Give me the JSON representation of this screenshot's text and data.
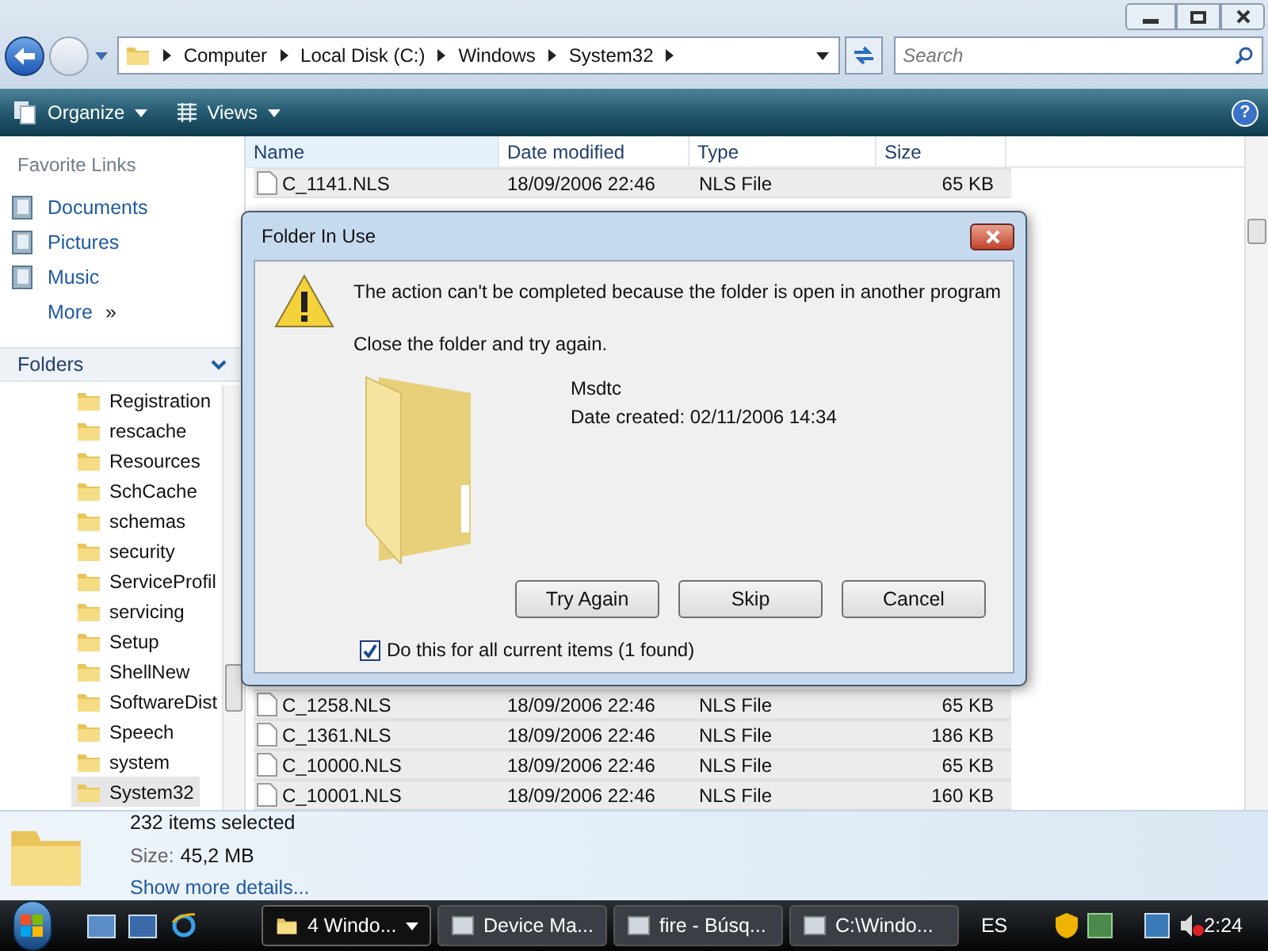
{
  "navigation": {
    "breadcrumbs": [
      "Computer",
      "Local Disk (C:)",
      "Windows",
      "System32"
    ],
    "search": {
      "placeholder": "Search"
    }
  },
  "toolbar": {
    "buttons": [
      "Organize",
      "Views"
    ],
    "help": "?"
  },
  "favorite_links": {
    "title": "Favorite Links",
    "items": [
      "Documents",
      "Pictures",
      "Music"
    ],
    "more": "More",
    "more_glyph": "»"
  },
  "folders": {
    "title": "Folders",
    "items": [
      {
        "name": "Registration",
        "selected": false
      },
      {
        "name": "rescache",
        "selected": false
      },
      {
        "name": "Resources",
        "selected": false
      },
      {
        "name": "SchCache",
        "selected": false
      },
      {
        "name": "schemas",
        "selected": false
      },
      {
        "name": "security",
        "selected": false
      },
      {
        "name": "ServiceProfil",
        "selected": false
      },
      {
        "name": "servicing",
        "selected": false
      },
      {
        "name": "Setup",
        "selected": false
      },
      {
        "name": "ShellNew",
        "selected": false
      },
      {
        "name": "SoftwareDist",
        "selected": false
      },
      {
        "name": "Speech",
        "selected": false
      },
      {
        "name": "system",
        "selected": false
      },
      {
        "name": "System32",
        "selected": true
      }
    ]
  },
  "table": {
    "columns": [
      "Name",
      "Date modified",
      "Type",
      "Size"
    ],
    "rows_above": [
      {
        "name": "C_1141.NLS",
        "date": "18/09/2006 22:46",
        "type": "NLS File",
        "size": "65 KB",
        "selected": true
      }
    ],
    "rows_below": [
      {
        "name": "C_1258.NLS",
        "date": "18/09/2006 22:46",
        "type": "NLS File",
        "size": "65 KB",
        "selected": true
      },
      {
        "name": "C_1361.NLS",
        "date": "18/09/2006 22:46",
        "type": "NLS File",
        "size": "186 KB",
        "selected": true
      },
      {
        "name": "C_10000.NLS",
        "date": "18/09/2006 22:46",
        "type": "NLS File",
        "size": "65 KB",
        "selected": true
      },
      {
        "name": "C_10001.NLS",
        "date": "18/09/2006 22:46",
        "type": "NLS File",
        "size": "160 KB",
        "selected": true
      }
    ]
  },
  "dialog": {
    "title": "Folder In Use",
    "message": "The action can't be completed because the folder is open in another program",
    "instruction": "Close the folder and try again.",
    "item": {
      "name": "Msdtc",
      "date_created": "Date created: 02/11/2006 14:34"
    },
    "buttons": [
      "Try Again",
      "Skip",
      "Cancel"
    ],
    "checkbox": {
      "label": "Do this for all current items (1 found)",
      "checked": true
    }
  },
  "details": {
    "title": "232 items selected",
    "size_label": "Size:",
    "size_value": "45,2 MB",
    "link": "Show more details..."
  },
  "taskbar": {
    "tasks": [
      {
        "label": "4 Windo...",
        "selected": true,
        "kind": "group"
      },
      {
        "label": "Device Ma...",
        "selected": false,
        "kind": "window"
      },
      {
        "label": "fire - Búsq...",
        "selected": false,
        "kind": "window"
      },
      {
        "label": "C:\\Windo...",
        "selected": false,
        "kind": "window"
      }
    ],
    "language": "ES",
    "clock": "2:24"
  }
}
